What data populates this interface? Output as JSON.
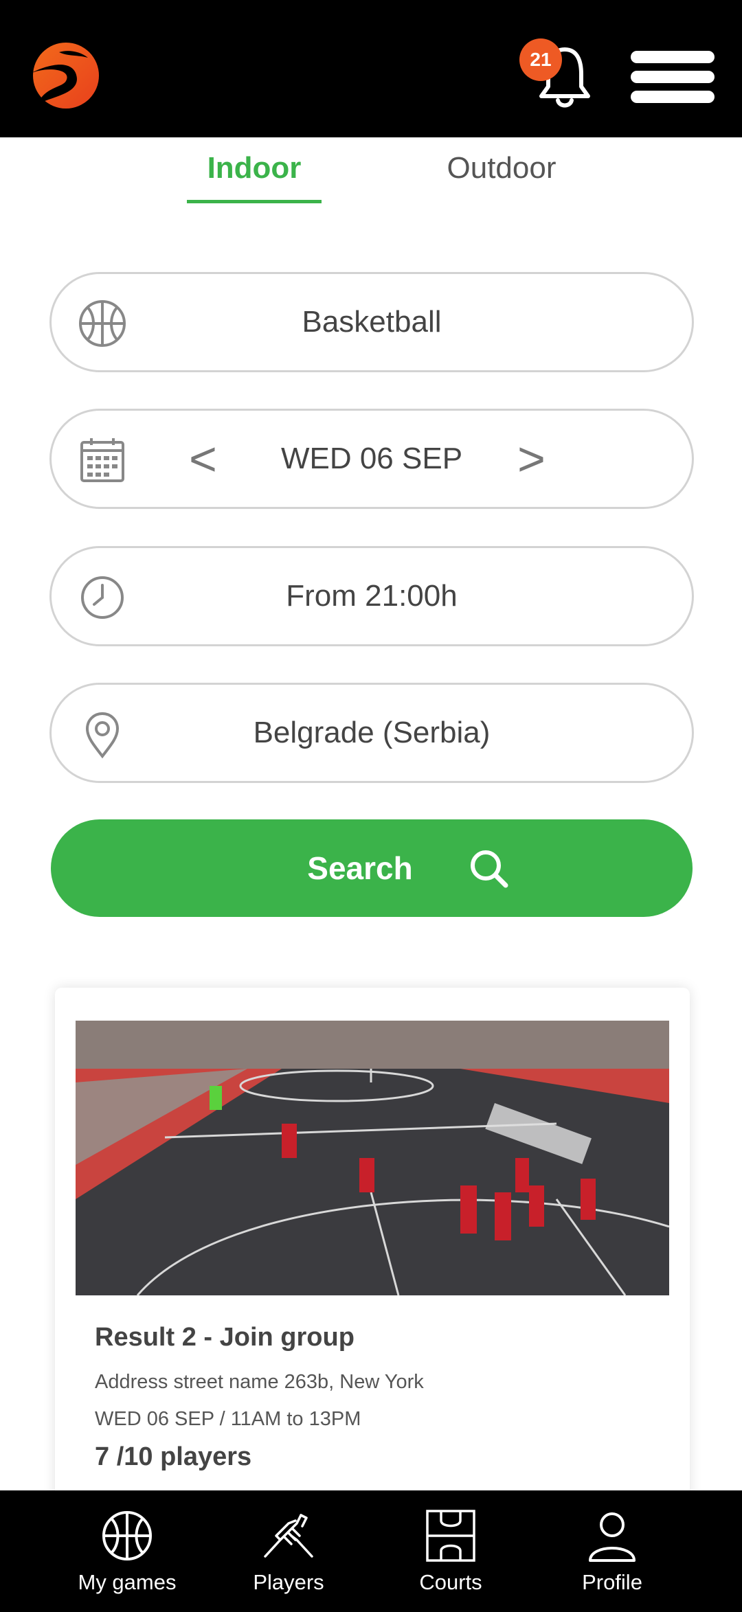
{
  "header": {
    "logo_icon": "app-logo-s",
    "notification_count": "21",
    "accent_color": "#ee5a24"
  },
  "tabs": [
    {
      "label": "Indoor",
      "active": true
    },
    {
      "label": "Outdoor",
      "active": false
    }
  ],
  "filters": {
    "sport": {
      "icon": "basketball-icon",
      "value": "Basketball"
    },
    "date": {
      "icon": "calendar-icon",
      "value": "WED 06 SEP",
      "prev": "<",
      "next": ">"
    },
    "time": {
      "icon": "clock-icon",
      "value": "From 21:00h"
    },
    "location": {
      "icon": "location-pin-icon",
      "value": "Belgrade (Serbia)"
    }
  },
  "search_button": {
    "label": "Search",
    "icon": "search-icon",
    "color": "#3bb34a"
  },
  "result_card": {
    "title": "Result 2 - Join group",
    "address": "Address street name 263b, New York",
    "schedule": "WED 06 SEP / 11AM to 13PM",
    "players": "7 /10 players"
  },
  "bottom_nav": [
    {
      "label": "My games",
      "icon": "basketball-icon"
    },
    {
      "label": "Players",
      "icon": "handshake-icon"
    },
    {
      "label": "Courts",
      "icon": "court-icon"
    },
    {
      "label": "Profile",
      "icon": "person-icon"
    }
  ]
}
